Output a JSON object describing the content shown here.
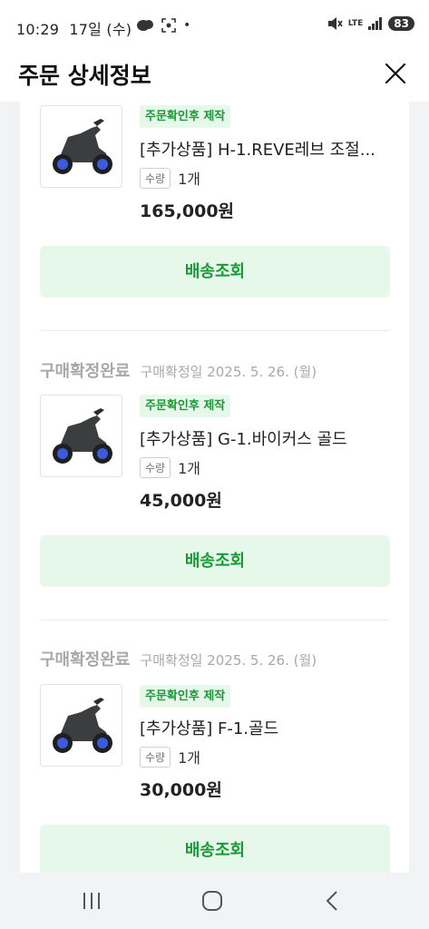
{
  "status_bar": {
    "time": "10:29",
    "date": "17일 (수)",
    "dot": "•",
    "network": "LTE",
    "battery": "83"
  },
  "header": {
    "title": "주문 상세정보"
  },
  "orders": [
    {
      "badge": "주문확인후 제작",
      "product_name": "[추가상품] H-1.REVE레브 조절...",
      "qty_label": "수량",
      "qty_value": "1개",
      "price": "165,000원",
      "track_label": "배송조회"
    },
    {
      "status": "구매확정완료",
      "confirm_date": "구매확정일 2025. 5. 26. (월)",
      "badge": "주문확인후 제작",
      "product_name": "[추가상품] G-1.바이커스 골드",
      "qty_label": "수량",
      "qty_value": "1개",
      "price": "45,000원",
      "track_label": "배송조회"
    },
    {
      "status": "구매확정완료",
      "confirm_date": "구매확정일 2025. 5. 26. (월)",
      "badge": "주문확인후 제작",
      "product_name": "[추가상품] F-1.골드",
      "qty_label": "수량",
      "qty_value": "1개",
      "price": "30,000원",
      "track_label": "배송조회"
    }
  ],
  "icons": {
    "close": "close-icon",
    "recent_apps": "recent-apps-icon",
    "home": "home-icon",
    "back": "back-icon"
  },
  "colors": {
    "accent_green": "#1a9a36",
    "accent_green_bg": "#e6f8ea",
    "muted_text": "#a8a8a8"
  }
}
